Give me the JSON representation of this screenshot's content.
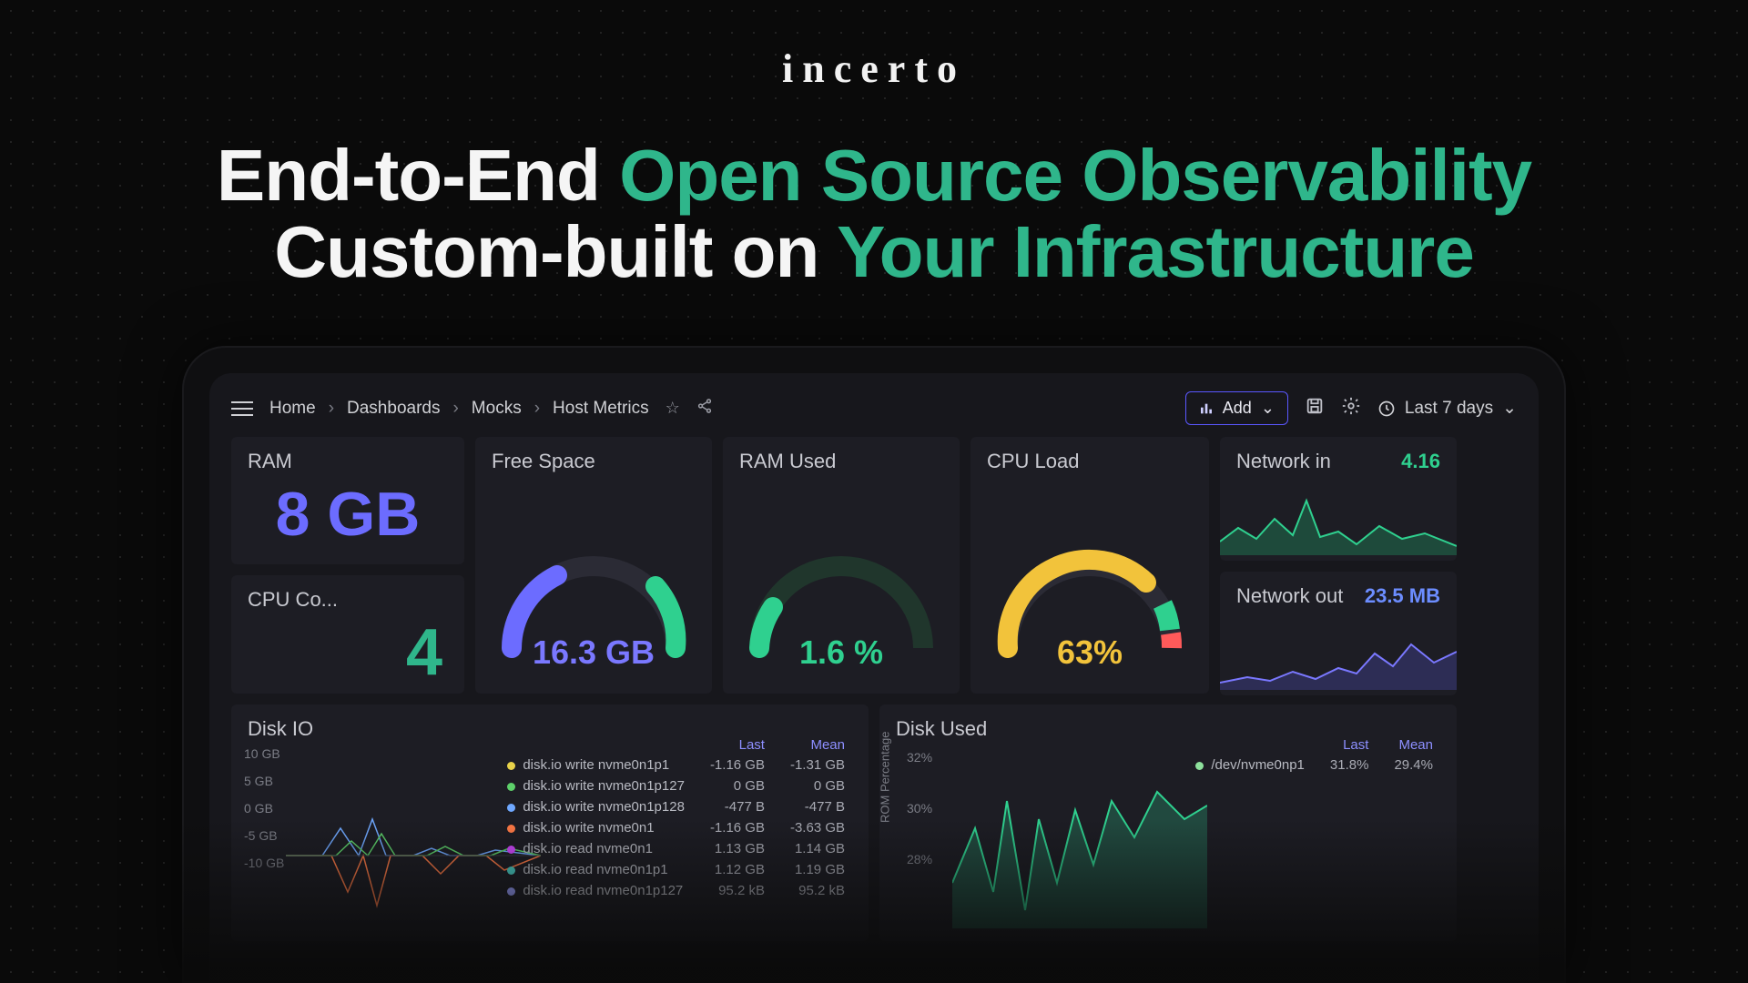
{
  "brand": "incerto",
  "headline": {
    "l1a": "End-to-End ",
    "l1b": "Open Source Observability",
    "l2a": "Custom-built on ",
    "l2b": "Your Infrastructure"
  },
  "toolbar": {
    "crumbs": [
      "Home",
      "Dashboards",
      "Mocks",
      "Host Metrics"
    ],
    "add_label": "Add",
    "range_label": "Last 7 days"
  },
  "panels": {
    "ram": {
      "title": "RAM",
      "value": "8 GB"
    },
    "cores": {
      "title": "CPU Co...",
      "value": "4"
    },
    "free": {
      "title": "Free Space",
      "value": "16.3 GB"
    },
    "ram_used": {
      "title": "RAM  Used",
      "value": "1.6 %"
    },
    "cpu_load": {
      "title": "CPU Load",
      "value": "63%"
    },
    "net_in": {
      "title": "Network in",
      "value": "4.16"
    },
    "net_out": {
      "title": "Network out",
      "value": "23.5 MB"
    },
    "disk_io": {
      "title": "Disk IO"
    },
    "disk_used": {
      "title": "Disk Used"
    }
  },
  "diskio": {
    "ylabels": [
      "10 GB",
      "5 GB",
      "0 GB",
      "-5 GB",
      "-10 GB"
    ],
    "headers": [
      "Last",
      "Mean"
    ],
    "rows": [
      {
        "color": "#e8d24a",
        "name": "disk.io write nvme0n1p1",
        "last": "-1.16 GB",
        "mean": "-1.31 GB"
      },
      {
        "color": "#5dd06a",
        "name": "disk.io write nvme0n1p127",
        "last": "0 GB",
        "mean": "0 GB"
      },
      {
        "color": "#6fa8ff",
        "name": "disk.io write nvme0n1p128",
        "last": "-477 B",
        "mean": "-477 B"
      },
      {
        "color": "#ff7a46",
        "name": "disk.io write nvme0n1",
        "last": "-1.16 GB",
        "mean": "-3.63 GB"
      },
      {
        "color": "#d14aff",
        "name": "disk.io read nvme0n1",
        "last": "1.13 GB",
        "mean": "1.14 GB"
      },
      {
        "color": "#4ad1c8",
        "name": "disk.io read nvme0n1p1",
        "last": "1.12 GB",
        "mean": "1.19 GB"
      },
      {
        "color": "#9aa0ff",
        "name": "disk.io read nvme0n1p127",
        "last": "95.2 kB",
        "mean": "95.2 kB"
      }
    ]
  },
  "diskused": {
    "ylabels": [
      "32%",
      "30%",
      "28%"
    ],
    "ytitle": "ROM Percentage",
    "headers": [
      "Last",
      "Mean"
    ],
    "rows": [
      {
        "color": "#8de09c",
        "name": "/dev/nvme0np1",
        "last": "31.8%",
        "mean": "29.4%"
      }
    ]
  },
  "chart_data": [
    {
      "type": "gauge",
      "title": "Free Space",
      "value": 16.3,
      "unit": "GB",
      "max": 64,
      "fraction": 0.25
    },
    {
      "type": "gauge",
      "title": "RAM Used",
      "value": 1.6,
      "unit": "%",
      "max": 100,
      "fraction": 0.016
    },
    {
      "type": "gauge",
      "title": "CPU Load",
      "value": 63,
      "unit": "%",
      "max": 100,
      "fraction": 0.63
    },
    {
      "type": "area",
      "title": "Network in",
      "value": 4.16,
      "series": [
        {
          "name": "in",
          "values": [
            1.2,
            1.8,
            1.0,
            2.3,
            1.4,
            4.1,
            1.6,
            1.2,
            0.9,
            2.0,
            1.5,
            1.1
          ]
        }
      ]
    },
    {
      "type": "area",
      "title": "Network out",
      "value": 23.5,
      "unit": "MB",
      "series": [
        {
          "name": "out",
          "values": [
            4,
            6,
            5,
            7,
            5,
            8,
            6,
            10,
            18,
            22,
            16,
            20
          ]
        }
      ]
    },
    {
      "type": "line",
      "title": "Disk IO",
      "ylabel": "GB",
      "ylim": [
        -10,
        10
      ],
      "series": [
        {
          "name": "disk.io write nvme0n1p1",
          "last": -1.16,
          "mean": -1.31
        },
        {
          "name": "disk.io write nvme0n1p127",
          "last": 0,
          "mean": 0
        },
        {
          "name": "disk.io write nvme0n1p128",
          "last": -4.77e-07,
          "mean": -4.77e-07
        },
        {
          "name": "disk.io write nvme0n1",
          "last": -1.16,
          "mean": -3.63
        },
        {
          "name": "disk.io read nvme0n1",
          "last": 1.13,
          "mean": 1.14
        },
        {
          "name": "disk.io read nvme0n1p1",
          "last": 1.12,
          "mean": 1.19
        },
        {
          "name": "disk.io read nvme0n1p127",
          "last": 9.52e-05,
          "mean": 9.52e-05
        }
      ]
    },
    {
      "type": "area",
      "title": "Disk Used",
      "ylabel": "ROM Percentage",
      "ylim": [
        28,
        32
      ],
      "series": [
        {
          "name": "/dev/nvme0np1",
          "last": 31.8,
          "mean": 29.4,
          "values": [
            29,
            30.5,
            29.2,
            31.8,
            28.5,
            31,
            29.5,
            30.8,
            31.5,
            31.2
          ]
        }
      ]
    }
  ]
}
